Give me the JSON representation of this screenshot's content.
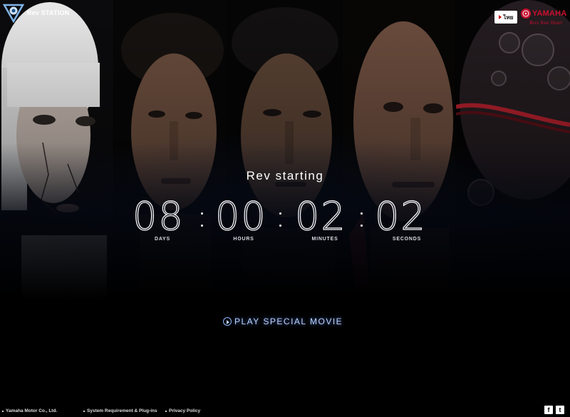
{
  "header": {
    "site_name": "Rev STATION",
    "lang_label": "ไทย",
    "brand_name": "YAMAHA",
    "brand_tagline": "Revs Your Heart"
  },
  "countdown": {
    "heading": "Rev starting",
    "days": "08",
    "hours": "00",
    "minutes": "02",
    "seconds": "02",
    "labels": {
      "days": "DAYS",
      "hours": "HOURS",
      "minutes": "MINUTES",
      "seconds": "SECONDS"
    }
  },
  "play_button": {
    "label": "PLAY SPECIAL MOVIE"
  },
  "footer": {
    "copyright": "Yamaha Motor Co., Ltd.",
    "links": [
      "System Requirement & Plug-ins",
      "Privacy Policy"
    ]
  },
  "social": {
    "facebook": "f",
    "twitter": "t"
  },
  "colors": {
    "background": "#000000",
    "brand_red": "#c8102e",
    "play_glow": "#5a96ff"
  }
}
